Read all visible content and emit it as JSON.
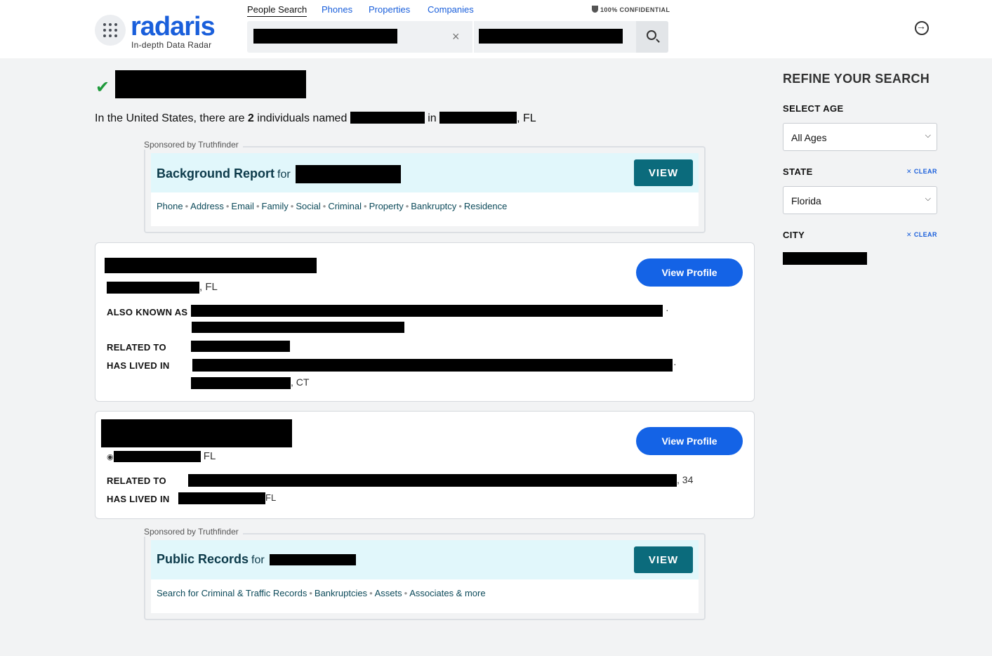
{
  "brand": {
    "name": "radaris",
    "tagline": "In-depth Data Radar"
  },
  "nav": {
    "tabs": [
      {
        "label": "People Search"
      },
      {
        "label": "Phones"
      },
      {
        "label": "Properties"
      },
      {
        "label": "Companies"
      }
    ],
    "confidential": "100% CONFIDENTIAL"
  },
  "search": {
    "clear_symbol": "×"
  },
  "summary": {
    "prefix": "In the United States, there are ",
    "count": "2",
    "middle": " individuals named ",
    "in_word": " in ",
    "state_suffix": ", FL"
  },
  "sponsor_top": {
    "label": "Sponsored by Truthfinder",
    "title": "Background Report",
    "for_word": "for",
    "button": "VIEW",
    "links": [
      "Phone",
      "Address",
      "Email",
      "Family",
      "Social",
      "Criminal",
      "Property",
      "Bankruptcy",
      "Residence"
    ]
  },
  "results": [
    {
      "location_suffix": ", FL",
      "button": "View Profile",
      "aka_label": "ALSO KNOWN AS",
      "related_label": "RELATED TO",
      "lived_label": "HAS LIVED IN",
      "lived_suffix": ", CT"
    },
    {
      "location_suffix": "FL",
      "button": "View Profile",
      "related_label": "RELATED TO",
      "related_suffix": ", 34",
      "lived_label": "HAS LIVED IN",
      "lived_suffix": "FL"
    }
  ],
  "sponsor_bottom": {
    "label": "Sponsored by Truthfinder",
    "title": "Public Records",
    "for_word": "for",
    "button": "VIEW",
    "links": [
      "Search for Criminal & Traffic Records",
      "Bankruptcies",
      "Assets",
      "Associates & more"
    ]
  },
  "sidebar": {
    "title": "REFINE YOUR SEARCH",
    "age_label": "SELECT AGE",
    "age_value": "All Ages",
    "state_label": "STATE",
    "state_value": "Florida",
    "city_label": "CITY",
    "clear_label": "CLEAR"
  },
  "colors": {
    "brand": "#1a5fdb",
    "sponsor_button": "#0b6b7c",
    "profile_button": "#1463e6",
    "check": "#1f9a3b"
  }
}
